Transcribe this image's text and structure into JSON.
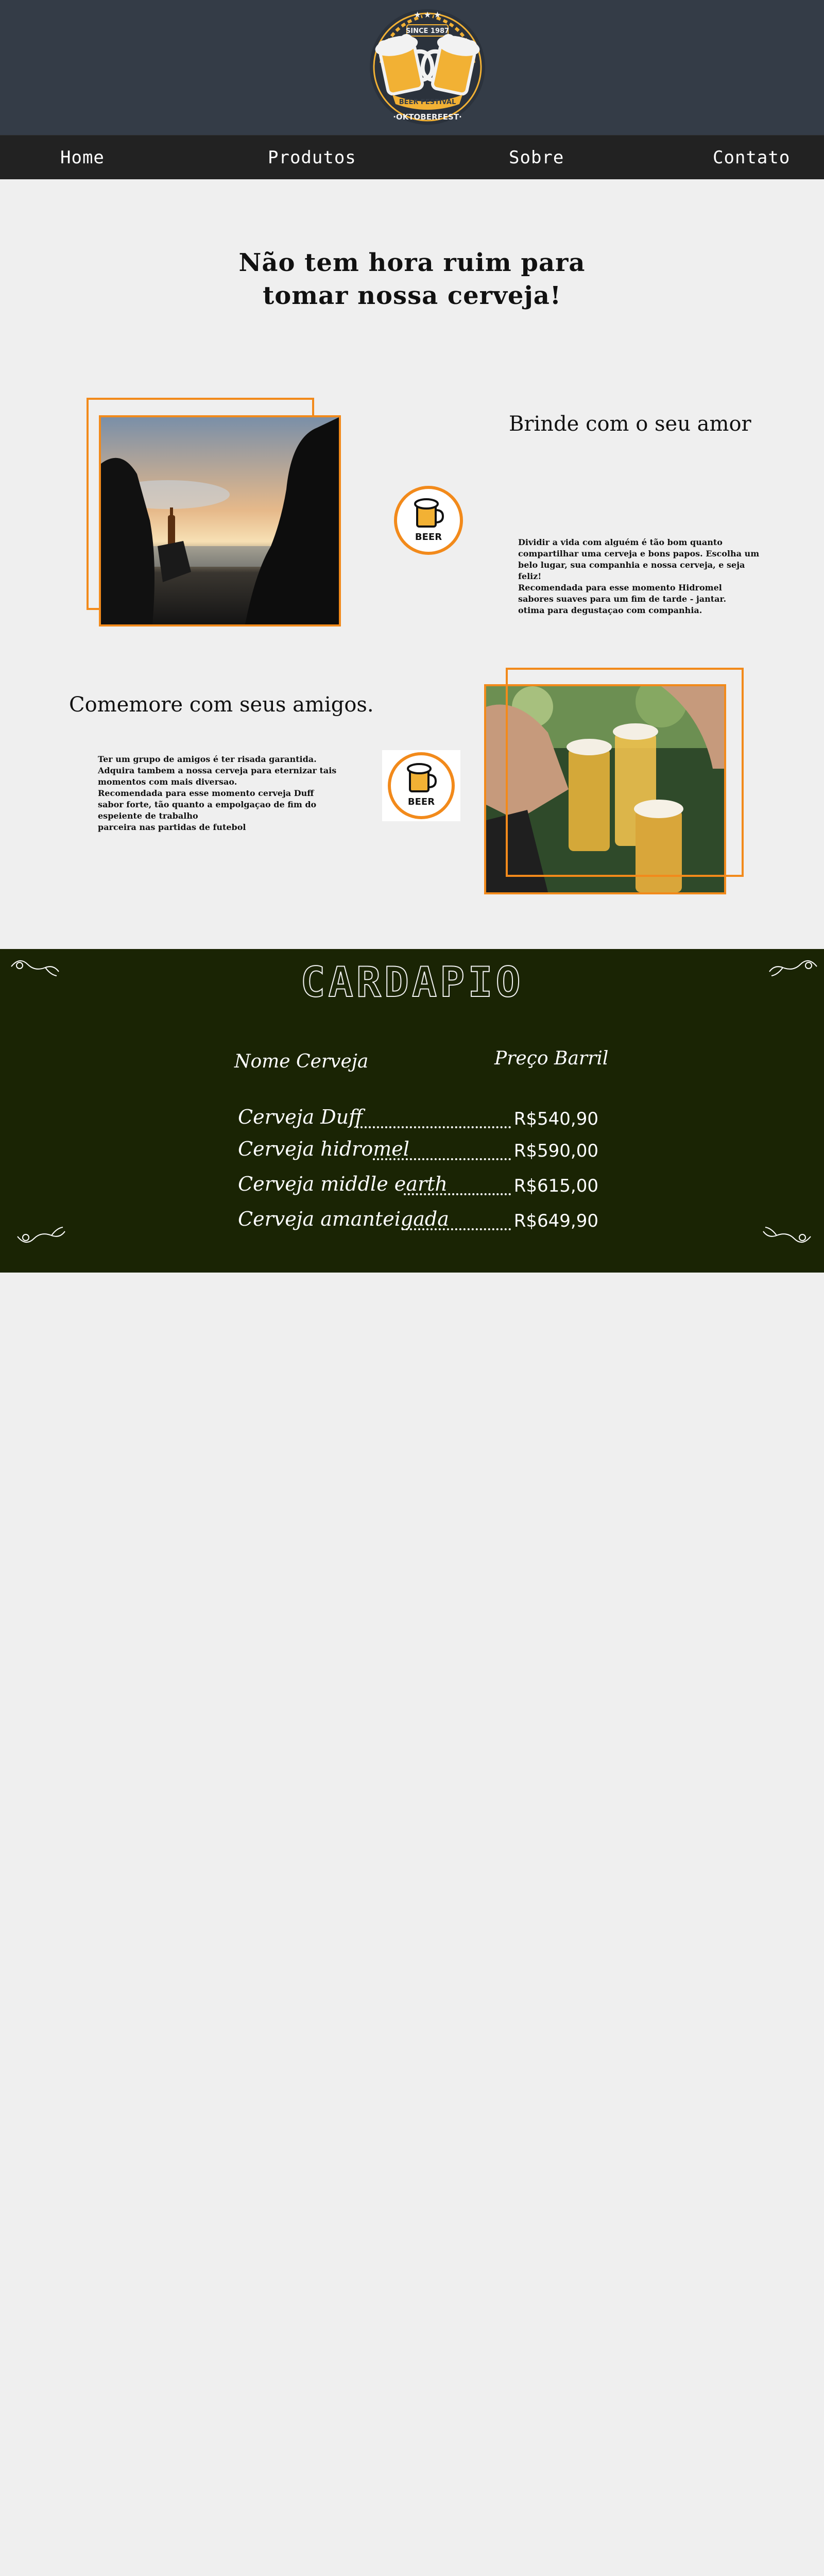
{
  "header": {
    "logo": {
      "top_text": "SINCE 1987",
      "ribbon_text": "BEER FESTIVAL",
      "bottom_text": "·OKTOBERFEST·",
      "icon": "beer-mugs-logo"
    }
  },
  "nav": {
    "items": [
      {
        "label": "Home"
      },
      {
        "label": "Produtos"
      },
      {
        "label": "Sobre"
      },
      {
        "label": "Contato"
      }
    ]
  },
  "intro": {
    "heading_line1": "Não tem hora ruim para",
    "heading_line2": "tomar nossa cerveja!"
  },
  "section_love": {
    "title": "Brinde com o seu amor",
    "badge_label": "BEER",
    "text_lines": [
      " Dividir a vida com alguém é tão bom quanto",
      "compartilhar uma cerveja e bons papos. Escolha um",
      "belo lugar, sua companhia e nossa cerveja, e seja",
      "feliz!",
      " Recomendada para esse momento Hidromel",
      "sabores suaves para um fim de tarde - jantar.",
      "otima para degustaçao com companhia."
    ]
  },
  "section_friends": {
    "title": "Comemore com seus amigos.",
    "badge_label": "BEER",
    "text_lines": [
      "Ter um grupo de amigos é ter risada garantida.",
      "Adquira tambem a nossa cerveja para eternizar tais",
      "momentos com mais diversao.",
      "Recomendada para esse momento cerveja Duff",
      "sabor forte, tão quanto a empolgaçao de fim do",
      "espeiente de trabalho",
      "parceira nas partidas de futebol"
    ]
  },
  "cardapio": {
    "title": "CARDAPIO",
    "col_name": "Nome Cerveja",
    "col_price": "Preço Barril",
    "items": [
      {
        "name": "Cerveja Duff",
        "price": "R$540,90"
      },
      {
        "name": "Cerveja hidromel",
        "price": "R$590,00"
      },
      {
        "name": "Cerveja middle earth",
        "price": "R$615,00"
      },
      {
        "name": "Cerveja amanteigada",
        "price": "R$649,90"
      }
    ]
  },
  "colors": {
    "header_bg": "#343c47",
    "nav_bg": "#222222",
    "accent_orange": "#f28a1b",
    "logo_gold": "#f2b134",
    "cardapio_bg": "#1a2404",
    "page_bg": "#efefef"
  }
}
